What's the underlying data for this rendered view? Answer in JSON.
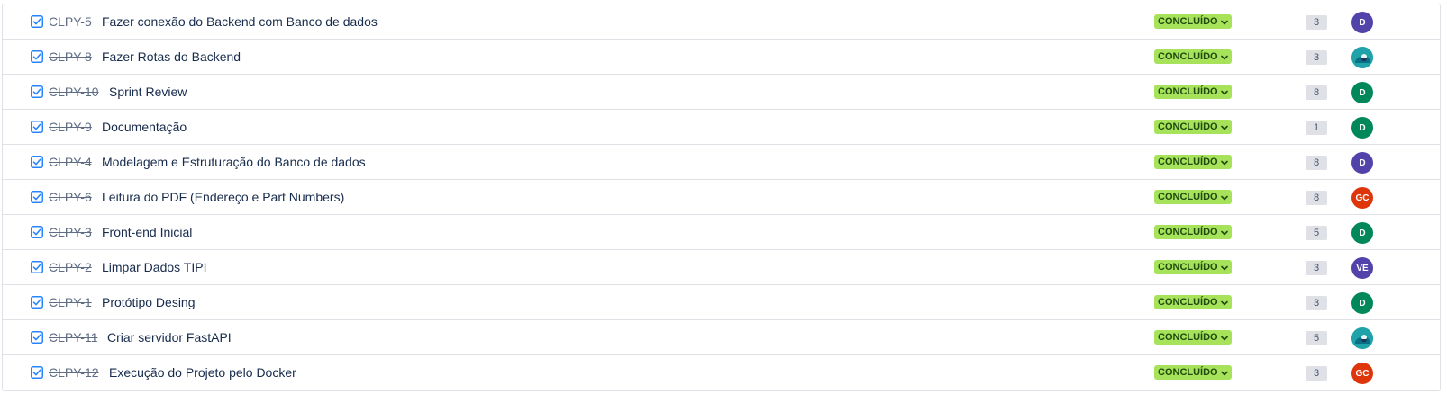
{
  "colors": {
    "status_bg": "#a6e35a",
    "status_text": "#1f4a0f",
    "checkbox_blue": "#2684ff",
    "avatar_purple": "#5243aa",
    "avatar_green": "#00875a",
    "avatar_red": "#de350b",
    "avatar_teal": "#00a3bf"
  },
  "issues": [
    {
      "key": "CLPY-5",
      "summary": "Fazer conexão do Backend com Banco de dados",
      "status": "CONCLUÍDO",
      "points": "3",
      "assignee": {
        "initials": "D",
        "color": "#5243aa",
        "type": "initials"
      }
    },
    {
      "key": "CLPY-8",
      "summary": "Fazer Rotas do Backend",
      "status": "CONCLUÍDO",
      "points": "3",
      "assignee": {
        "initials": "",
        "color": "#00a3bf",
        "type": "image-avatar-icon"
      }
    },
    {
      "key": "CLPY-10",
      "summary": "Sprint Review",
      "status": "CONCLUÍDO",
      "points": "8",
      "assignee": {
        "initials": "D",
        "color": "#00875a",
        "type": "initials"
      }
    },
    {
      "key": "CLPY-9",
      "summary": "Documentação",
      "status": "CONCLUÍDO",
      "points": "1",
      "assignee": {
        "initials": "D",
        "color": "#00875a",
        "type": "initials"
      }
    },
    {
      "key": "CLPY-4",
      "summary": "Modelagem e Estruturação do Banco de dados",
      "status": "CONCLUÍDO",
      "points": "8",
      "assignee": {
        "initials": "D",
        "color": "#5243aa",
        "type": "initials"
      }
    },
    {
      "key": "CLPY-6",
      "summary": "Leitura do PDF (Endereço e Part Numbers)",
      "status": "CONCLUÍDO",
      "points": "8",
      "assignee": {
        "initials": "GC",
        "color": "#de350b",
        "type": "initials"
      }
    },
    {
      "key": "CLPY-3",
      "summary": "Front-end Inicial",
      "status": "CONCLUÍDO",
      "points": "5",
      "assignee": {
        "initials": "D",
        "color": "#00875a",
        "type": "initials"
      }
    },
    {
      "key": "CLPY-2",
      "summary": "Limpar Dados TIPI",
      "status": "CONCLUÍDO",
      "points": "3",
      "assignee": {
        "initials": "VE",
        "color": "#5243aa",
        "type": "initials"
      }
    },
    {
      "key": "CLPY-1",
      "summary": "Protótipo Desing",
      "status": "CONCLUÍDO",
      "points": "3",
      "assignee": {
        "initials": "D",
        "color": "#00875a",
        "type": "initials"
      }
    },
    {
      "key": "CLPY-11",
      "summary": "Criar servidor FastAPI",
      "status": "CONCLUÍDO",
      "points": "5",
      "assignee": {
        "initials": "",
        "color": "#00a3bf",
        "type": "image-avatar-icon"
      }
    },
    {
      "key": "CLPY-12",
      "summary": "Execução do Projeto pelo Docker",
      "status": "CONCLUÍDO",
      "points": "3",
      "assignee": {
        "initials": "GC",
        "color": "#de350b",
        "type": "initials"
      }
    }
  ]
}
